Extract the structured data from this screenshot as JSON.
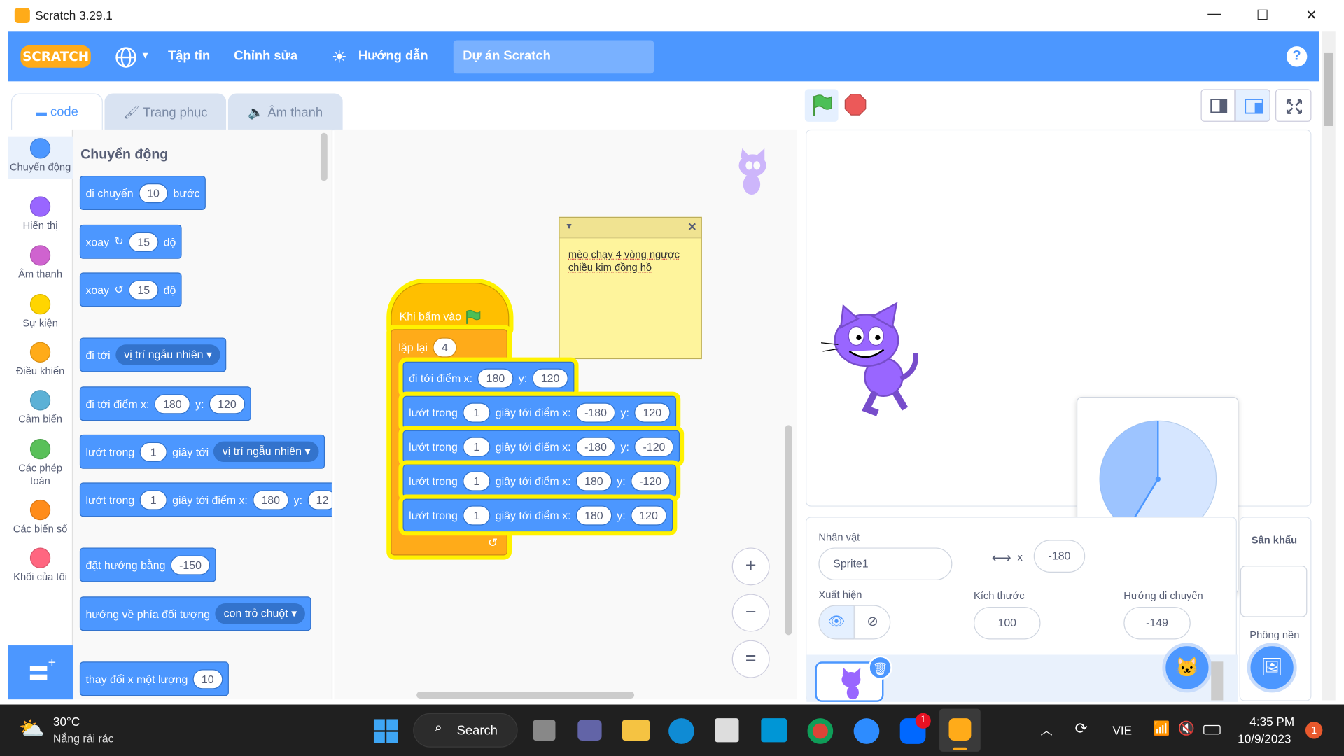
{
  "window": {
    "title": "Scratch 3.29.1",
    "minimize": "—",
    "maximize": "☐",
    "close": "✕"
  },
  "menubar": {
    "logo": "SCRATCH",
    "file": "Tập tin",
    "edit": "Chỉnh sửa",
    "tutorials": "Hướng dẫn",
    "project_title": "Dự án Scratch",
    "help": "?"
  },
  "tabs": [
    {
      "label": "code"
    },
    {
      "label": "Trang phục"
    },
    {
      "label": "Âm thanh"
    }
  ],
  "categories": [
    {
      "label": "Chuyển động",
      "color": "#4c97ff"
    },
    {
      "label": "Hiển thị",
      "color": "#9966ff"
    },
    {
      "label": "Âm thanh",
      "color": "#cf63cf"
    },
    {
      "label": "Sự kiện",
      "color": "#ffd500"
    },
    {
      "label": "Điều khiển",
      "color": "#ffab19"
    },
    {
      "label": "Cảm biến",
      "color": "#5cb1d6"
    },
    {
      "label": "Các phép toán",
      "color": "#59c059"
    },
    {
      "label": "Các biến số",
      "color": "#ff8c1a"
    },
    {
      "label": "Khối của tôi",
      "color": "#ff6680"
    }
  ],
  "palette": {
    "heading": "Chuyển động",
    "move": {
      "a": "di chuyển",
      "v": "10",
      "b": "bước"
    },
    "turn_right": {
      "a": "xoay",
      "v": "15",
      "b": "độ"
    },
    "turn_left": {
      "a": "xoay",
      "v": "15",
      "b": "độ"
    },
    "goto": {
      "a": "đi tới",
      "dd": "vị trí ngẫu nhiên"
    },
    "goto_xy": {
      "a": "đi tới điểm x:",
      "x": "180",
      "y_label": "y:",
      "y": "120"
    },
    "glide": {
      "a": "lướt trong",
      "v": "1",
      "b": "giây tới",
      "dd": "vị trí ngẫu nhiên"
    },
    "glide_xy": {
      "a": "lướt trong",
      "v": "1",
      "b": "giây tới điểm x:",
      "x": "180",
      "y_label": "y:",
      "y": "12"
    },
    "point_dir": {
      "a": "đặt hướng bằng",
      "v": "-150"
    },
    "point_towards": {
      "a": "hướng về phía đối tượng",
      "dd": "con trỏ chuột"
    },
    "change_x": {
      "a": "thay đổi x một lượng",
      "v": "10"
    }
  },
  "script": {
    "hat": "Khi bấm vào",
    "repeat": {
      "label": "lặp lại",
      "v": "4"
    },
    "goto": {
      "a": "đi tới điểm x:",
      "x": "180",
      "y_label": "y:",
      "y": "120"
    },
    "glides": [
      {
        "a": "lướt trong",
        "t": "1",
        "b": "giây tới điểm x:",
        "x": "-180",
        "y_label": "y:",
        "y": "120"
      },
      {
        "a": "lướt trong",
        "t": "1",
        "b": "giây tới điểm x:",
        "x": "-180",
        "y_label": "y:",
        "y": "-120"
      },
      {
        "a": "lướt trong",
        "t": "1",
        "b": "giây tới điểm x:",
        "x": "180",
        "y_label": "y:",
        "y": "-120"
      },
      {
        "a": "lướt trong",
        "t": "1",
        "b": "giây tới điểm x:",
        "x": "180",
        "y_label": "y:",
        "y": "120"
      }
    ],
    "comment": "mèo chạy 4 vòng ngược chiều kim đồng hồ",
    "zoom_in": "+",
    "zoom_out": "−",
    "zoom_reset": "="
  },
  "sprite": {
    "label": "Nhân vật",
    "name": "Sprite1",
    "x_label": "x",
    "x": "-180",
    "show_label": "Xuất hiện",
    "size_label": "Kích thước",
    "size": "100",
    "direction_label": "Hướng di chuyển",
    "direction": "-149"
  },
  "stage_pane": {
    "label": "Sân khấu",
    "backdrop": "Phông nền"
  },
  "taskbar": {
    "temp": "30°C",
    "weather": "Nắng rải rác",
    "search": "Search",
    "lang": "VIE",
    "time": "4:35 PM",
    "date": "10/9/2023",
    "notif": "1",
    "badge": "1"
  }
}
